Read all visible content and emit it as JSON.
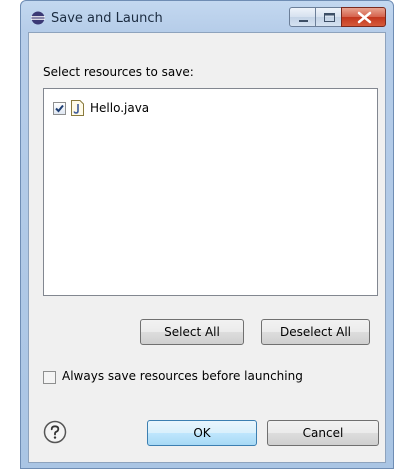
{
  "window": {
    "title": "Save and Launch"
  },
  "dialog": {
    "select_label": "Select resources to save:",
    "resources": [
      {
        "name": "Hello.java",
        "checked": true
      }
    ],
    "select_all_label": "Select All",
    "deselect_all_label": "Deselect All",
    "always_save_label": "Always save resources before launching",
    "always_save_checked": false,
    "ok_label": "OK",
    "cancel_label": "Cancel"
  }
}
